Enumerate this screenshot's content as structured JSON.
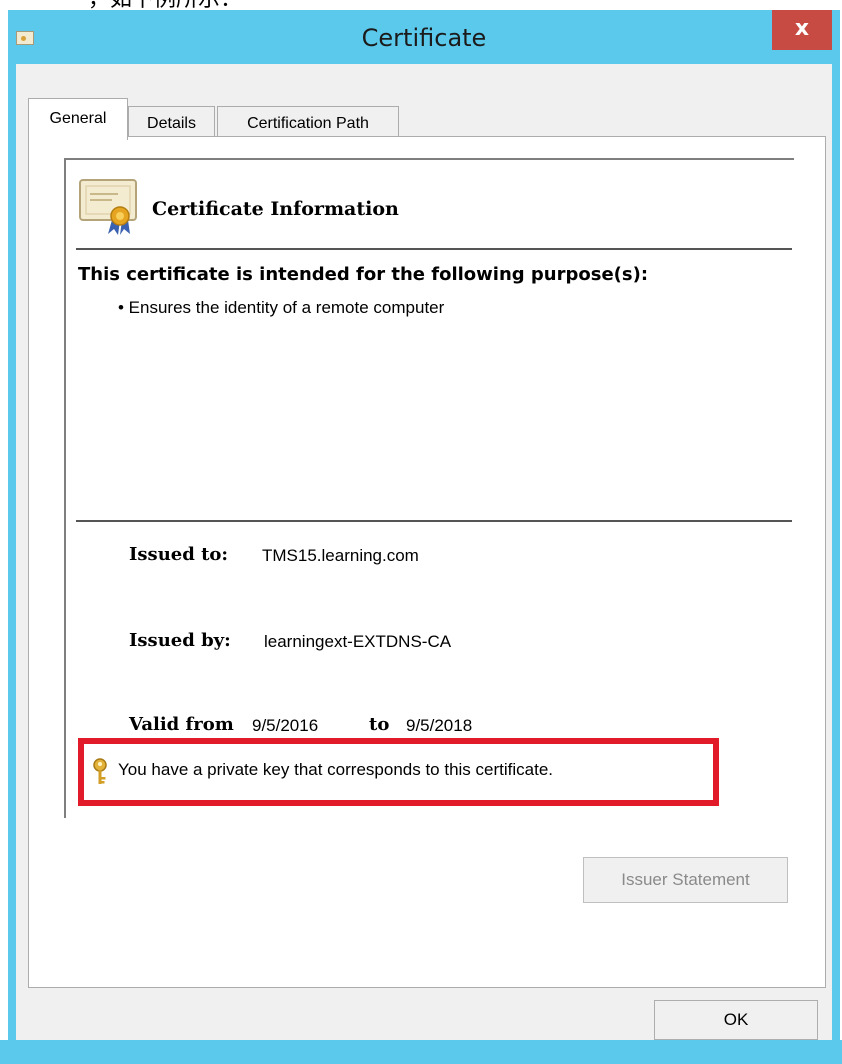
{
  "caption": "，如下例所示：",
  "window": {
    "title": "Certificate",
    "close_label": "x"
  },
  "tabs": [
    {
      "label": "General",
      "active": true
    },
    {
      "label": "Details",
      "active": false
    },
    {
      "label": "Certification Path",
      "active": false
    }
  ],
  "cert": {
    "heading": "Certificate Information",
    "purpose_heading": "This certificate is intended for the following purpose(s):",
    "purposes": [
      "• Ensures the identity of a remote computer"
    ],
    "issued_to_label": "Issued to:",
    "issued_to": "TMS15.learning.com",
    "issued_by_label": "Issued by:",
    "issued_by": "learningext-EXTDNS-CA",
    "valid_from_label": "Valid from",
    "valid_from": "9/5/2016",
    "to_label": "to",
    "valid_to": "9/5/2018",
    "private_key_text": "You have a private key that corresponds to this certificate."
  },
  "buttons": {
    "issuer_statement": "Issuer Statement",
    "ok": "OK"
  },
  "colors": {
    "titlebar": "#5bc9ec",
    "close": "#c74a43",
    "highlight": "#e11b2a"
  }
}
